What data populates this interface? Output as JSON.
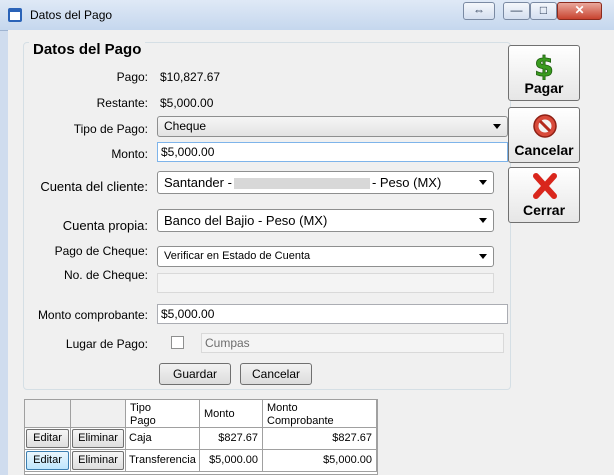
{
  "window": {
    "title": "Datos del Pago",
    "caption_restore": "⇔",
    "caption_min": "—",
    "caption_max": "□",
    "caption_close": "✕"
  },
  "form": {
    "group_title": "Datos del Pago",
    "pago_label": "Pago:",
    "pago_value": "$10,827.67",
    "restante_label": "Restante:",
    "restante_value": "$5,000.00",
    "tipo_label": "Tipo de Pago:",
    "tipo_value": "Cheque",
    "monto_label": "Monto:",
    "monto_value": "$5,000.00",
    "cuenta_cliente_label": "Cuenta del cliente:",
    "cuenta_cliente_prefix": "Santander -",
    "cuenta_cliente_suffix": "- Peso (MX)",
    "cuenta_propia_label": "Cuenta propia:",
    "cuenta_propia_value": "Banco del Bajio - Peso (MX)",
    "pago_cheque_label": "Pago de Cheque:",
    "pago_cheque_value": "Verificar en Estado de Cuenta",
    "no_cheque_label": "No. de Cheque:",
    "no_cheque_value": "",
    "monto_comprobante_label": "Monto comprobante:",
    "monto_comprobante_value": "$5,000.00",
    "lugar_label": "Lugar de Pago:",
    "lugar_placeholder": "Cumpas",
    "guardar": "Guardar",
    "cancelar": "Cancelar"
  },
  "actions": {
    "pagar": "Pagar",
    "cancelar": "Cancelar",
    "cerrar": "Cerrar"
  },
  "table": {
    "headers": [
      "",
      "",
      "Tipo\nPago",
      "Monto",
      "Monto\nComprobante"
    ],
    "rows": [
      {
        "edit": "Editar",
        "delete": "Eliminar",
        "tipo": "Caja",
        "monto": "$827.67",
        "comprobante": "$827.67"
      },
      {
        "edit": "Editar",
        "delete": "Eliminar",
        "tipo": "Transferencia",
        "monto": "$5,000.00",
        "comprobante": "$5,000.00"
      }
    ]
  },
  "colors": {
    "pagar_icon": "#3a9b1f",
    "cancelar_icon": "#c0392b",
    "cerrar_icon": "#d9261c"
  }
}
